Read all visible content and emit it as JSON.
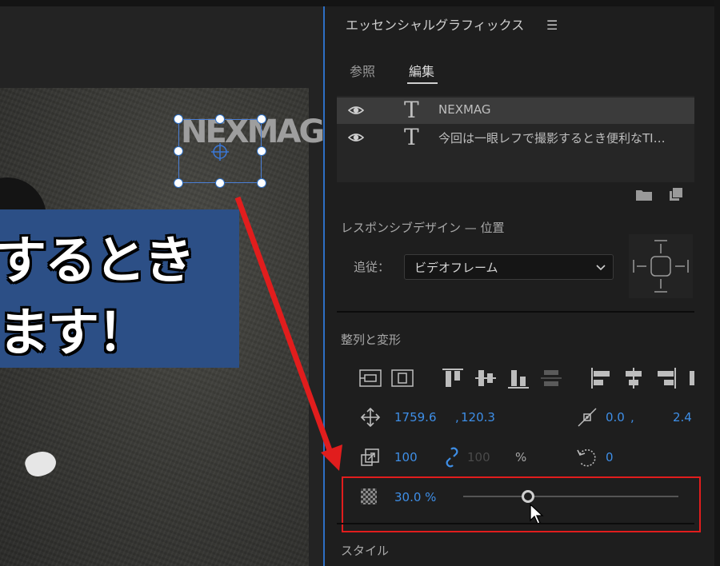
{
  "monitor": {
    "banner_line_1": "するとき",
    "banner_line_2": "ます！",
    "logo_text": "NEXMAG"
  },
  "panel": {
    "title": "エッセンシャルグラフィックス",
    "menu_icon": "hamburger-menu-icon",
    "tabs": [
      {
        "label": "参照",
        "active": false
      },
      {
        "label": "編集",
        "active": true
      }
    ],
    "layers": [
      {
        "name": "NEXMAG",
        "selected": true,
        "icon": "eye-icon",
        "type_icon": "T"
      },
      {
        "name": "今回は一眼レフで撮影するとき便利なTI…",
        "selected": false,
        "icon": "eye-icon",
        "type_icon": "T"
      }
    ],
    "responsive": {
      "title": "レスポンシブデザイン — 位置",
      "follow_label": "追従：",
      "follow_value": "ビデオフレーム"
    },
    "align": {
      "title": "整列と変形"
    },
    "transform": {
      "position_x": "1759.6",
      "position_y": "120.3",
      "position_sep": ",",
      "anchor_x": "0.0",
      "anchor_sep": ",",
      "anchor_y": "2.4",
      "scale_width": "100",
      "scale_height": "100",
      "scale_unit": "%",
      "rotation": "0"
    },
    "opacity": {
      "value_text": "30.0 %",
      "value": 30.0
    },
    "style_title": "スタイル"
  },
  "colors": {
    "accent_blue": "#3e8ee6",
    "highlight_red": "#e11d1d",
    "panel_bg": "#1e1e1e",
    "banner_blue": "#2c4f86"
  }
}
